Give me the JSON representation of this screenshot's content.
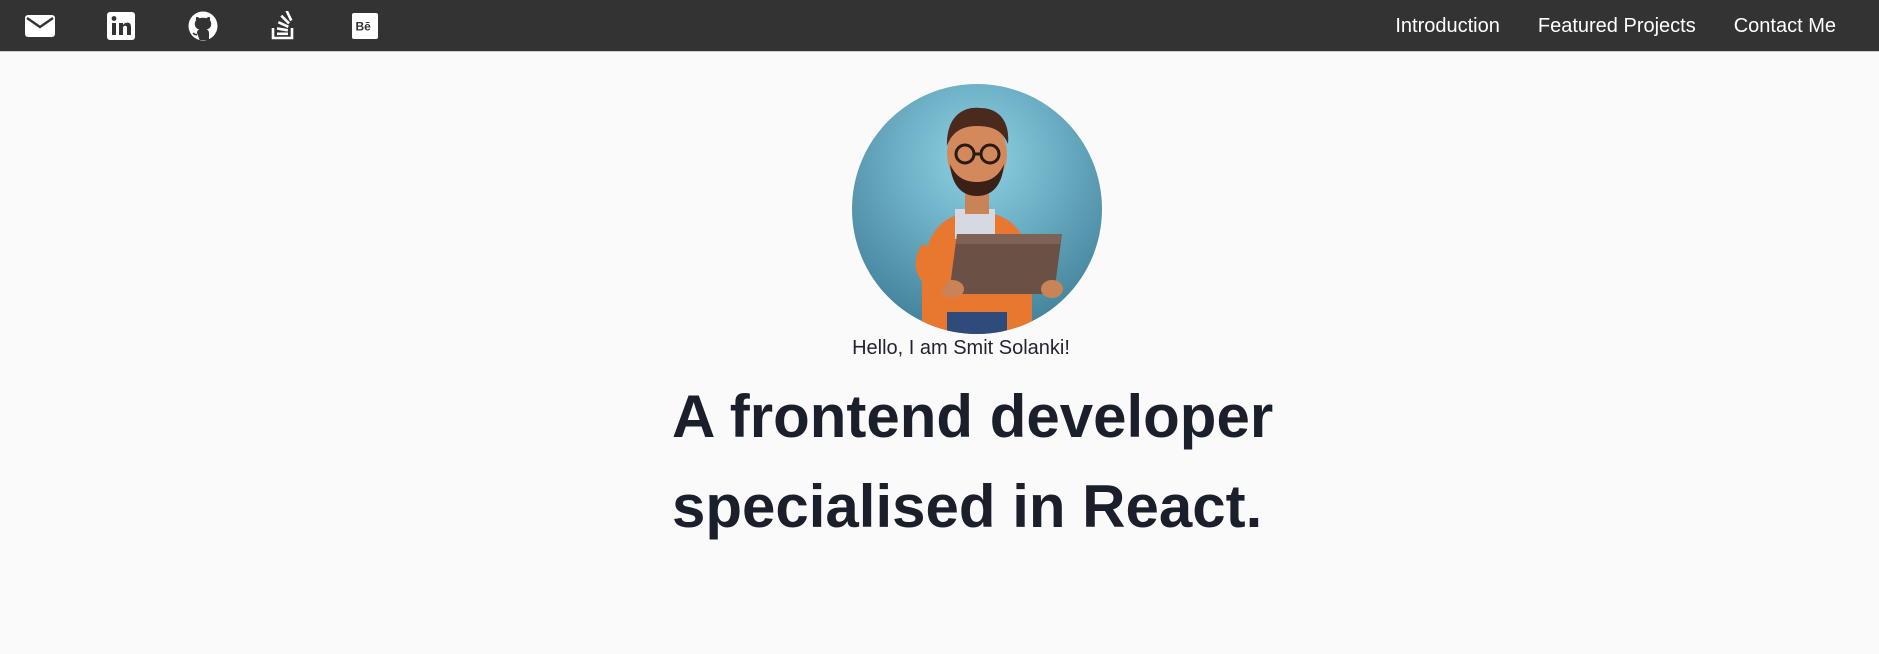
{
  "nav": {
    "social": [
      {
        "name": "email",
        "icon": "email-icon"
      },
      {
        "name": "linkedin",
        "icon": "linkedin-icon"
      },
      {
        "name": "github",
        "icon": "github-icon"
      },
      {
        "name": "stackoverflow",
        "icon": "stackoverflow-icon"
      },
      {
        "name": "behance",
        "icon": "behance-icon"
      }
    ],
    "links": [
      "Introduction",
      "Featured Projects",
      "Contact Me"
    ]
  },
  "hero": {
    "avatar": "developer-avatar",
    "greeting": "Hello, I am Smit Solanki!",
    "headline_line1": "A frontend developer",
    "headline_line2": "specialised in React."
  },
  "colors": {
    "navbar": "#333333",
    "background": "#fafafa",
    "text": "#1b1f2b"
  }
}
